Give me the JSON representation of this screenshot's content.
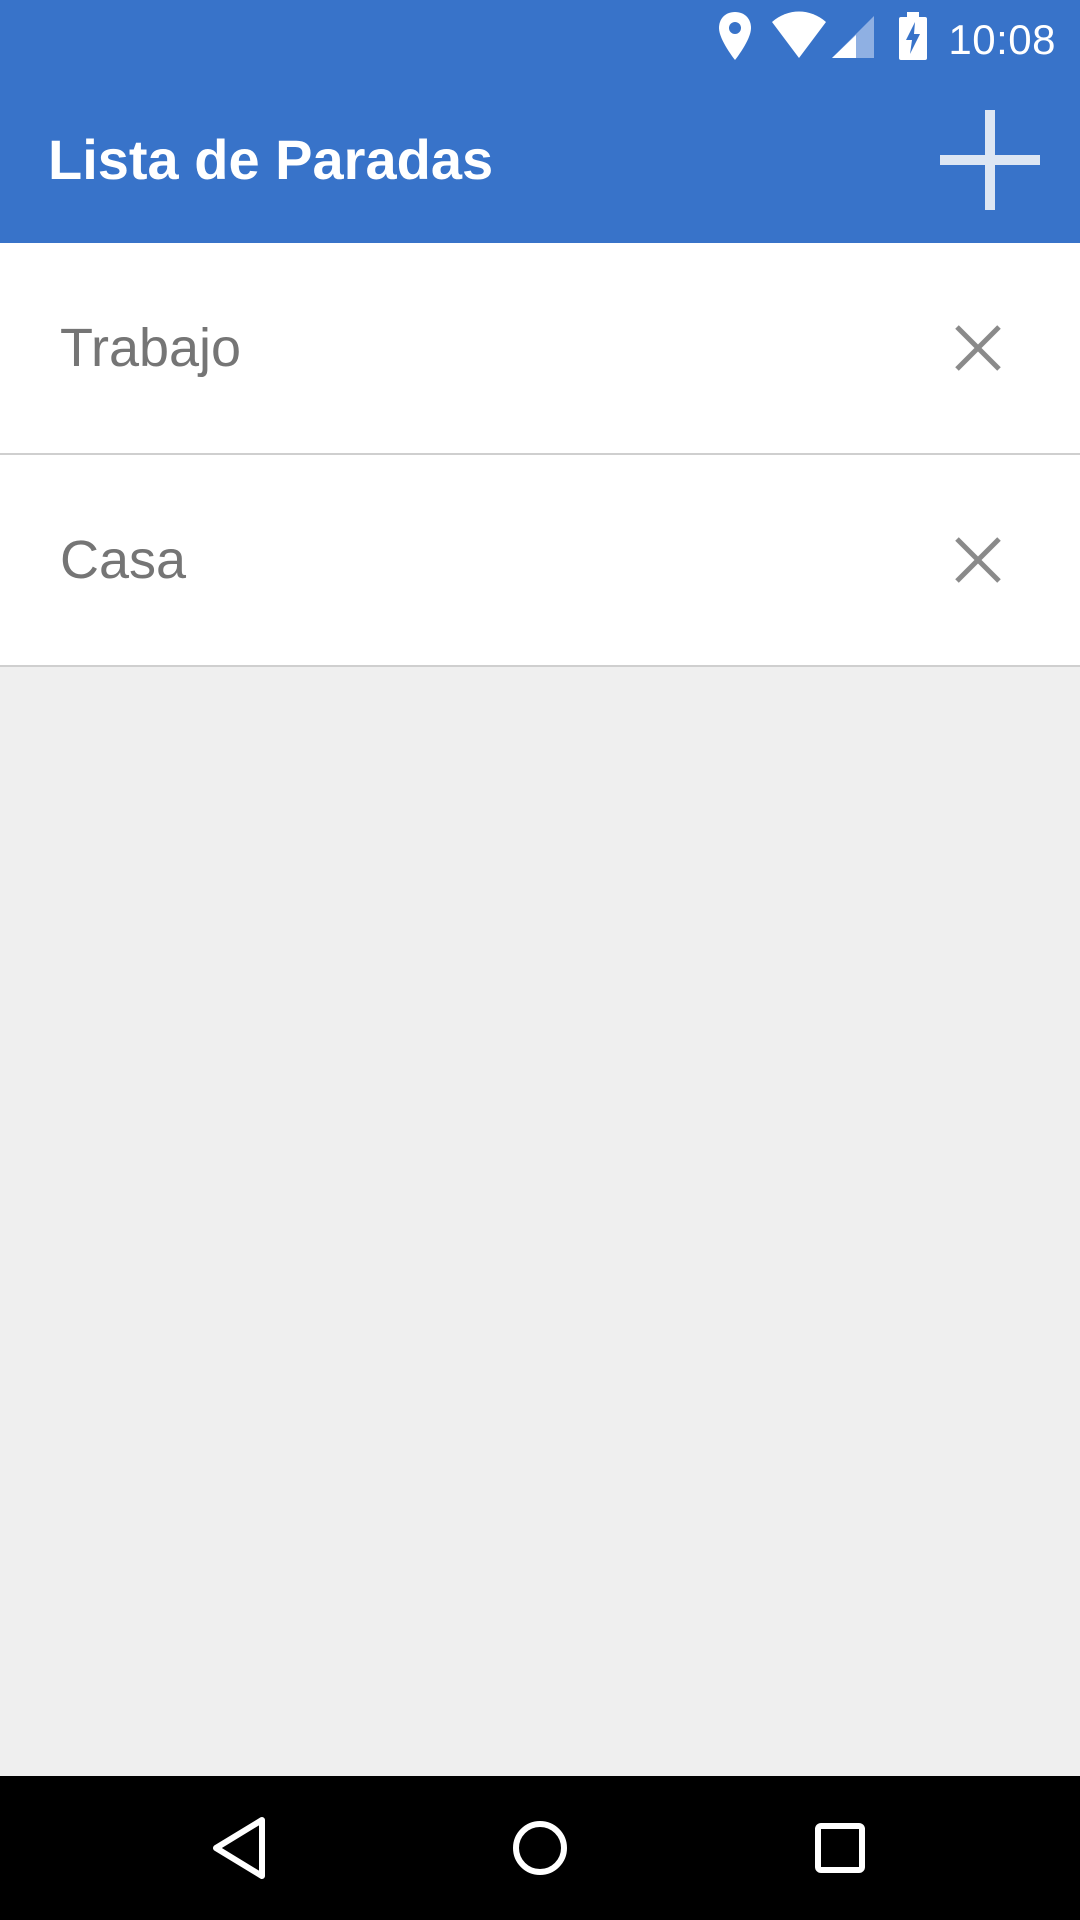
{
  "colors": {
    "app_bar": "#3873c9",
    "list_background": "#ffffff",
    "screen_background": "#efefef",
    "item_text": "#757575",
    "remove_icon": "#8a8a8a",
    "nav_bar": "#000000"
  },
  "status_bar": {
    "time": "10:08",
    "icons": [
      "location-icon",
      "wifi-icon",
      "cell-signal-icon",
      "battery-charging-icon"
    ]
  },
  "app_bar": {
    "title": "Lista de Paradas",
    "action_icon": "plus-icon"
  },
  "stops": [
    {
      "label": "Trabajo",
      "action_icon": "close-icon"
    },
    {
      "label": "Casa",
      "action_icon": "close-icon"
    }
  ],
  "nav_bar": {
    "buttons": [
      "back-icon",
      "home-icon",
      "recents-icon"
    ]
  }
}
